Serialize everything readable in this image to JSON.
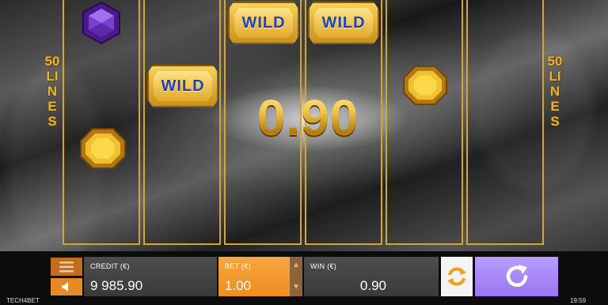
{
  "game": {
    "lines_label_left": "50 LINES",
    "lines_label_right": "50 LINES",
    "win_display": "0.90",
    "reels": [
      {
        "symbols": [
          "purple-gem"
        ]
      },
      {
        "symbols": [
          "wild"
        ]
      },
      {
        "symbols": [
          "wild"
        ]
      },
      {
        "symbols": [
          "wild"
        ]
      },
      {
        "symbols": [
          "gold-gem"
        ]
      },
      {
        "symbols": []
      }
    ],
    "wild_text": "WILD",
    "extra_symbols": [
      "gold-gem"
    ]
  },
  "controls": {
    "credit_label": "CREDIT (€)",
    "credit_value": "9 985.90",
    "bet_label": "BET (€)",
    "bet_value": "1.00",
    "win_label": "WIN (€)",
    "win_value": "0.90"
  },
  "footer": {
    "brand": "TECH4BET",
    "clock": "19:59"
  },
  "colors": {
    "reel_border": "#d6a52c",
    "bet_panel": "#ee8e22",
    "spin_button": "#9a76f0",
    "menu_button": "#c06d1d",
    "gold_text": "#e8b632",
    "wild_text": "#1c44b8"
  },
  "icons": [
    "menu-icon",
    "speaker-icon",
    "autoplay-icon",
    "spin-icon",
    "bet-up-icon",
    "bet-down-icon"
  ]
}
